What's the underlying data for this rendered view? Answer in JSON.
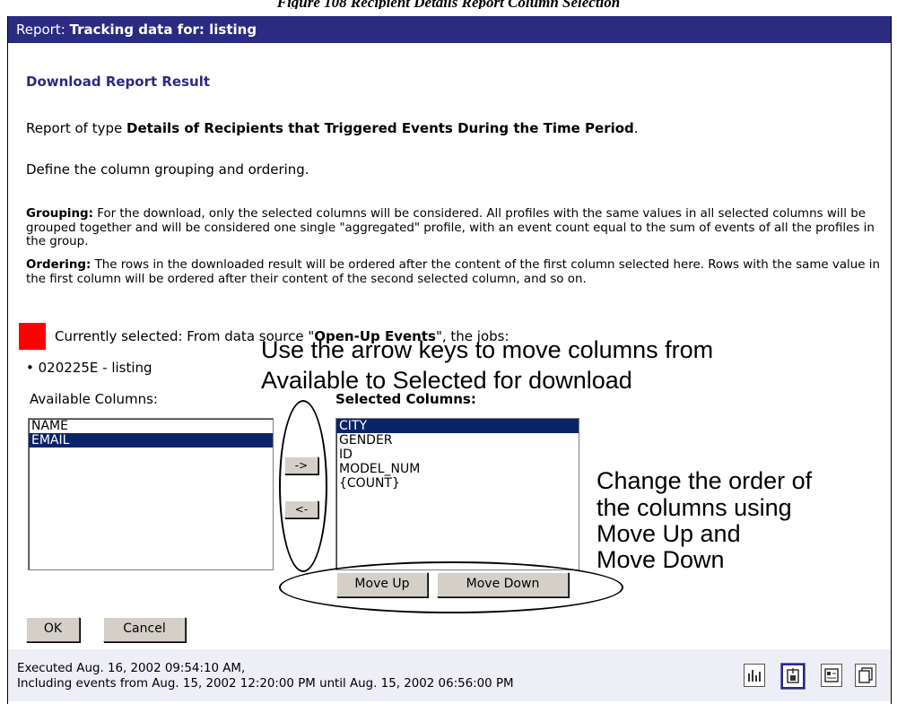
{
  "caption": "Figure 108 Recipient Details Report Column Selection",
  "titlebar": {
    "prefix": "Report: ",
    "title": "Tracking data for: listing"
  },
  "heading": "Download Report Result",
  "report_type": {
    "prefix": "Report of type ",
    "name": "Details of Recipients that Triggered Events During the Time Period",
    "suffix": "."
  },
  "define_text": "Define the column grouping and ordering.",
  "grouping": {
    "label": "Grouping:",
    "text": " For the download, only the selected columns will be considered. All profiles with the same values in all selected columns will be grouped together and will be considered one single \"aggregated\" profile, with an event count equal to the sum of events of all the profiles in the group."
  },
  "ordering": {
    "label": "Ordering:",
    "text": " The rows in the downloaded result will be ordered after the content of the first column selected here. Rows with the same value in the first column will be ordered after their content of the second selected column, and so on."
  },
  "selection": {
    "prefix": "Currently selected: From data source \"",
    "source": "Open-Up Events",
    "suffix": "\", the jobs:",
    "jobs": [
      "020225E - listing"
    ]
  },
  "callouts": {
    "arrow_line1": "Use the arrow keys to move columns from",
    "arrow_line2": "Available to Selected for download",
    "order_line1": "Change the order of",
    "order_line2": "the columns using",
    "order_line3": "Move Up and",
    "order_line4": "Move Down"
  },
  "available": {
    "label": "Available Columns:",
    "items": [
      "NAME",
      "EMAIL"
    ],
    "selected_index": 1
  },
  "selected": {
    "label": "Selected Columns:",
    "items": [
      "CITY",
      "GENDER",
      "ID",
      "MODEL_NUM",
      "{COUNT}"
    ],
    "selected_index": 0
  },
  "buttons": {
    "add": "->",
    "remove": "<-",
    "move_up": "Move Up",
    "move_down": "Move Down",
    "ok": "OK",
    "cancel": "Cancel"
  },
  "footer": {
    "executed": "Executed Aug. 16, 2002 09:54:10 AM,",
    "range": "Including events from Aug. 15, 2002 12:20:00 PM until Aug. 15, 2002 06:56:00 PM",
    "icons": [
      "bar-chart-icon",
      "download-icon",
      "report-details-icon",
      "copy-pages-icon"
    ]
  },
  "colors": {
    "titlebar": "#2b2b82",
    "heading": "#2b2b82",
    "selection": "#0a246a",
    "marker": "#ff0000"
  }
}
